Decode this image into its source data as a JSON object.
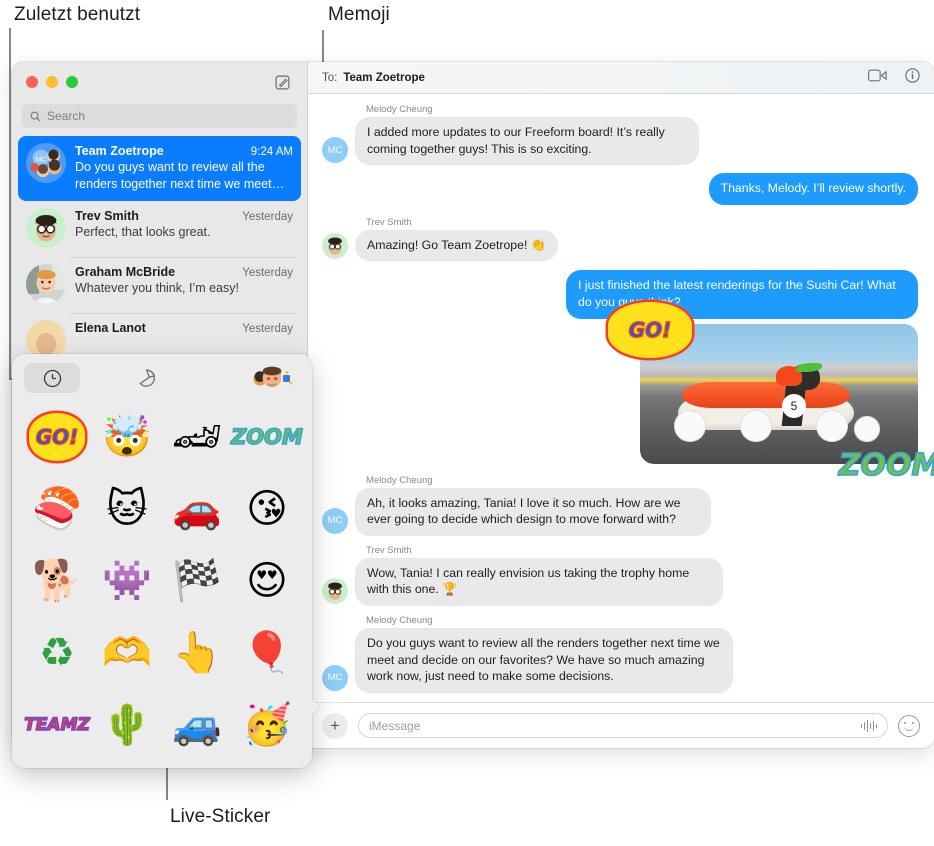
{
  "callouts": [
    {
      "id": "recents",
      "label": "Zuletzt benutzt"
    },
    {
      "id": "memoji",
      "label": "Memoji"
    },
    {
      "id": "live-sticker",
      "label": "Live-Sticker"
    }
  ],
  "window": {
    "traffic_lights": [
      "close",
      "minimize",
      "zoom"
    ],
    "compose_icon": "compose-pencil-square-icon"
  },
  "sidebar": {
    "search": {
      "placeholder": "Search",
      "icon": "search-icon"
    },
    "conversations": [
      {
        "name": "Team Zoetrope",
        "time": "9:24 AM",
        "preview": "Do you guys want to review all the renders together next time we meet…",
        "selected": true,
        "avatar": "group-avatar-cluster"
      },
      {
        "name": "Trev Smith",
        "time": "Yesterday",
        "preview": "Perfect, that looks great.",
        "selected": false,
        "avatar": "memoji-avatar-glasses"
      },
      {
        "name": "Graham McBride",
        "time": "Yesterday",
        "preview": "Whatever you think, I’m easy!",
        "selected": false,
        "avatar": "photo-avatar-graham"
      },
      {
        "name": "Elena Lanot",
        "time": "Yesterday",
        "preview": "",
        "selected": false,
        "avatar": "photo-avatar-elena"
      }
    ]
  },
  "conversation": {
    "to_label": "To:",
    "to_name": "Team Zoetrope",
    "facetime_icon": "video-camera-icon",
    "info_icon": "info-circle-icon",
    "messages": [
      {
        "direction": "in",
        "sender": "Melody Cheung",
        "avatar_initials": "MC",
        "text": "I added more updates to our Freeform board! It’s really coming together guys! This is so exciting."
      },
      {
        "direction": "out",
        "sender": "",
        "text": "Thanks, Melody. I’ll review shortly."
      },
      {
        "direction": "in",
        "sender": "Trev Smith",
        "avatar_initials": "",
        "text": "Amazing! Go Team Zoetrope! 👏"
      },
      {
        "direction": "out",
        "sender": "",
        "text": "I just finished the latest renderings for the Sushi Car! What do you guys think?"
      },
      {
        "direction": "in",
        "sender": "Melody Cheung",
        "avatar_initials": "MC",
        "text": "Ah, it looks amazing, Tania! I love it so much. How are we ever going to decide which design to move forward with?"
      },
      {
        "direction": "in",
        "sender": "Trev Smith",
        "avatar_initials": "",
        "text": "Wow, Tania! I can really envision us taking the trophy home with this one. 🏆"
      },
      {
        "direction": "in",
        "sender": "Melody Cheung",
        "avatar_initials": "MC",
        "text": "Do you guys want to review all the renders together next time we meet and decide on our favorites? We have so much amazing work now, just need to make some decisions."
      }
    ],
    "attachment": {
      "description": "sushi-soapbox-race-car-photo",
      "car_number": "5",
      "stickers": [
        {
          "name": "go-sticker",
          "text": "GO!"
        },
        {
          "name": "zoom-sticker",
          "text": "ZOOM"
        }
      ]
    },
    "input": {
      "plus_label": "+",
      "placeholder": "iMessage",
      "audio_icon": "audio-waveform-icon",
      "emoji_icon": "emoji-smiley-icon"
    }
  },
  "sticker_picker": {
    "tabs": [
      {
        "id": "recents",
        "icon": "clock-icon",
        "selected": true
      },
      {
        "id": "live-stickers",
        "icon": "sticker-peel-icon",
        "selected": false
      },
      {
        "id": "memoji",
        "icon": "memoji-faces-icon",
        "selected": false
      }
    ],
    "stickers": [
      {
        "name": "go-wordart-sticker",
        "kind": "wordart",
        "text": "GO!",
        "style": "go"
      },
      {
        "name": "memoji-mind-blown-sticker",
        "kind": "emoji",
        "glyph": "🤯"
      },
      {
        "name": "race-car-sticker",
        "kind": "emoji",
        "glyph": "🏎"
      },
      {
        "name": "zoom-wordart-sticker",
        "kind": "wordart",
        "text": "ZOOM",
        "style": "zoom"
      },
      {
        "name": "sushi-nigiri-sticker",
        "kind": "emoji",
        "glyph": "🍣"
      },
      {
        "name": "grumpy-cat-sticker",
        "kind": "emoji",
        "glyph": "🐱"
      },
      {
        "name": "flaming-car-sticker",
        "kind": "emoji",
        "glyph": "🚗"
      },
      {
        "name": "memoji-kiss-sticker",
        "kind": "emoji",
        "glyph": "😘"
      },
      {
        "name": "dog-sunglasses-sticker",
        "kind": "emoji",
        "glyph": "🐕"
      },
      {
        "name": "monster-teeth-sticker",
        "kind": "emoji",
        "glyph": "👾"
      },
      {
        "name": "checkered-flag-sticker",
        "kind": "emoji",
        "glyph": "🏁"
      },
      {
        "name": "memoji-heart-eyes-sticker",
        "kind": "emoji",
        "glyph": "😍"
      },
      {
        "name": "recycle-symbol-sticker",
        "kind": "emoji",
        "glyph": "♻"
      },
      {
        "name": "memoji-heart-hands-sticker",
        "kind": "emoji",
        "glyph": "🫶"
      },
      {
        "name": "foam-finger-sticker",
        "kind": "emoji",
        "glyph": "👆"
      },
      {
        "name": "hot-air-balloon-sticker",
        "kind": "emoji",
        "glyph": "🎈"
      },
      {
        "name": "teamz-wordart-sticker",
        "kind": "wordart",
        "text": "TEAMZ",
        "style": "teamz"
      },
      {
        "name": "cactus-sticker",
        "kind": "emoji",
        "glyph": "🌵"
      },
      {
        "name": "blue-car-sticker",
        "kind": "emoji",
        "glyph": "🚙"
      },
      {
        "name": "memoji-party-horn-sticker",
        "kind": "emoji",
        "glyph": "🥳"
      }
    ]
  },
  "colors": {
    "accent_blue": "#0a7cff",
    "bubble_out": "#1e9bff",
    "bubble_in": "#e9e9eb",
    "sidebar_bg": "#e8e8e8",
    "picker_bg": "#ececec"
  }
}
